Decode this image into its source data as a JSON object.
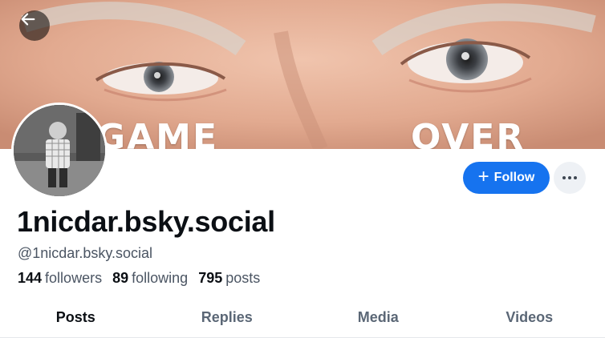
{
  "banner": {
    "text_left": "GAME",
    "text_right": "OVER"
  },
  "profile": {
    "display_name": "1nicdar.bsky.social",
    "handle": "@1nicdar.bsky.social",
    "followers_count": "144",
    "followers_label": "followers",
    "following_count": "89",
    "following_label": "following",
    "posts_count": "795",
    "posts_label": "posts"
  },
  "actions": {
    "follow_icon": "+",
    "follow_label": "Follow",
    "more_icon": "ellipsis-icon"
  },
  "nav": {
    "back_icon": "arrow-left-icon"
  },
  "tabs": [
    {
      "label": "Posts",
      "active": true
    },
    {
      "label": "Replies",
      "active": false
    },
    {
      "label": "Media",
      "active": false
    },
    {
      "label": "Videos",
      "active": false
    }
  ],
  "colors": {
    "accent": "#1673ef",
    "text_primary": "#0b0f14",
    "text_secondary": "#4b5563"
  }
}
